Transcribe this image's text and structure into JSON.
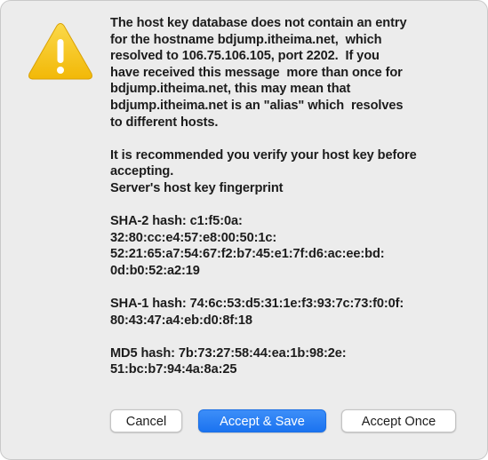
{
  "dialog": {
    "icon": "warning-triangle-icon",
    "colors": {
      "icon_yellow": "#f6c71b",
      "accent": "#1b73f0",
      "background": "#ececec"
    },
    "message_lines": [
      "The host key database does not contain an entry",
      "for the hostname bdjump.itheima.net,  which",
      "resolved to 106.75.106.105, port 2202.  If you",
      "have received this message  more than once for",
      "bdjump.itheima.net, this may mean that",
      "bdjump.itheima.net is an \"alias\" which  resolves",
      "to different hosts.",
      "",
      "It is recommended you verify your host key before",
      "accepting.",
      "Server's host key fingerprint",
      "",
      "SHA-2 hash: c1:f5:0a:",
      "32:80:cc:e4:57:e8:00:50:1c:",
      "52:21:65:a7:54:67:f2:b7:45:e1:7f:d6:ac:ee:bd:",
      "0d:b0:52:a2:19",
      "",
      "SHA-1 hash: 74:6c:53:d5:31:1e:f3:93:7c:73:f0:0f:",
      "80:43:47:a4:eb:d0:8f:18",
      "",
      "MD5 hash: 7b:73:27:58:44:ea:1b:98:2e:",
      "51:bc:b7:94:4a:8a:25"
    ],
    "buttons": {
      "cancel": "Cancel",
      "accept_save": "Accept & Save",
      "accept_once": "Accept Once"
    }
  }
}
